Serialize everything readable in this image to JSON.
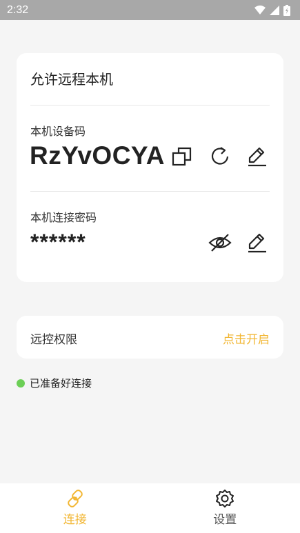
{
  "status_bar": {
    "time": "2:32",
    "icons": [
      "wifi-icon",
      "signal-icon",
      "battery-icon"
    ]
  },
  "main_card": {
    "title": "允许远程本机",
    "device_code_label": "本机设备码",
    "device_code": "RzYvOCYA",
    "password_label": "本机连接密码",
    "password_masked": "******"
  },
  "permission": {
    "label": "远控权限",
    "action": "点击开启"
  },
  "connection_status": {
    "text": "已准备好连接",
    "color": "#6ccf56"
  },
  "bottom_nav": {
    "items": [
      {
        "label": "连接",
        "icon": "link-icon",
        "active": true
      },
      {
        "label": "设置",
        "icon": "gear-icon",
        "active": false
      }
    ]
  },
  "colors": {
    "accent": "#f2b632",
    "background": "#f5f5f5",
    "status_bar": "#a8a8a8"
  }
}
